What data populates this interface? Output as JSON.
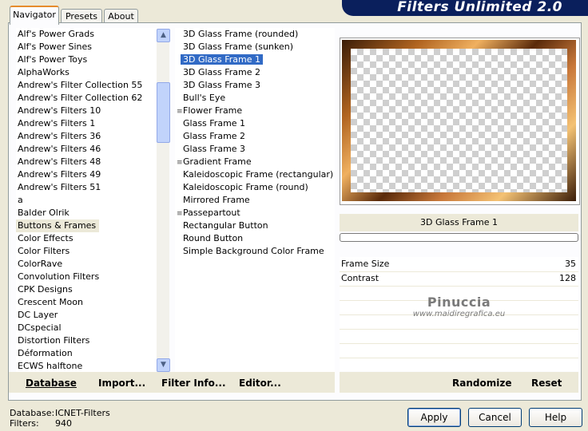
{
  "title": "Filters Unlimited 2.0",
  "tabs": [
    "Navigator",
    "Presets",
    "About"
  ],
  "categories": [
    "Alf's Power Grads",
    "Alf's Power Sines",
    "Alf's Power Toys",
    "AlphaWorks",
    "Andrew's Filter Collection 55",
    "Andrew's Filter Collection 62",
    "Andrew's Filters 10",
    "Andrew's Filters 1",
    "Andrew's Filters 36",
    "Andrew's Filters 46",
    "Andrew's Filters 48",
    "Andrew's Filters 49",
    "Andrew's Filters 51",
    "a",
    "Balder Olrik",
    "Buttons & Frames",
    "Color Effects",
    "Color Filters",
    "ColorRave",
    "Convolution Filters",
    "CPK Designs",
    "Crescent Moon",
    "DC Layer",
    "DCspecial",
    "Distortion Filters",
    "Déformation",
    "ECWS halftone"
  ],
  "selected_category": "Buttons & Frames",
  "filters": [
    "3D Glass Frame (rounded)",
    "3D Glass Frame (sunken)",
    "3D Glass Frame 1",
    "3D Glass Frame 2",
    "3D Glass Frame 3",
    "Bull's Eye",
    "Flower Frame",
    "Glass Frame 1",
    "Glass Frame 2",
    "Glass Frame 3",
    "Gradient Frame",
    "Kaleidoscopic Frame (rectangular)",
    "Kaleidoscopic Frame (round)",
    "Mirrored Frame",
    "Passepartout",
    "Rectangular Button",
    "Round Button",
    "Simple Background Color Frame"
  ],
  "marked_filters": [
    "Flower Frame",
    "Gradient Frame",
    "Passepartout"
  ],
  "selected_filter": "3D Glass Frame 1",
  "filter_name": "3D Glass Frame 1",
  "params": [
    {
      "label": "Frame Size",
      "value": "35"
    },
    {
      "label": "Contrast",
      "value": "128"
    }
  ],
  "watermark": {
    "line1": "Pinuccia",
    "line2": "www.maidiregrafica.eu"
  },
  "buttons": {
    "database": "Database",
    "import": "Import...",
    "filter_info": "Filter Info...",
    "editor": "Editor...",
    "randomize": "Randomize",
    "reset": "Reset",
    "apply": "Apply",
    "cancel": "Cancel",
    "help": "Help"
  },
  "footer": {
    "database_label": "Database:",
    "database_value": "ICNET-Filters",
    "filters_label": "Filters:",
    "filters_value": "940"
  },
  "colors": {
    "selection": "#316ac5",
    "banner": "#0a1f5c",
    "tab_accent": "#e68b2c"
  },
  "icons": {
    "scroll_up": "▲",
    "scroll_down": "▼",
    "mark": "≡"
  }
}
